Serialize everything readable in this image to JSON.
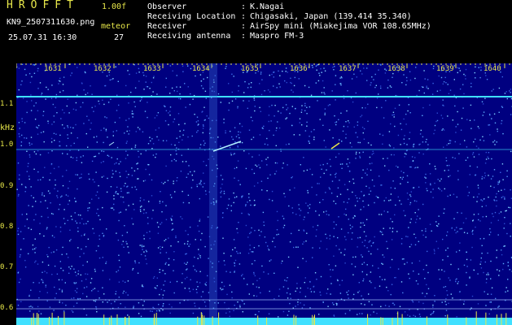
{
  "header": {
    "app_name": "HROFFT",
    "version": "1.00f",
    "filename": "KN9_2507311630.png",
    "datetime": "25.07.31 16:30",
    "meteor_label": "meteor",
    "meteor_count": "27"
  },
  "info": [
    {
      "label": "Observer",
      "value": "K.Nagai"
    },
    {
      "label": "Receiving Location",
      "value": "Chigasaki, Japan (139.414 35.340)"
    },
    {
      "label": "Receiver",
      "value": "AirSpy mini (Miakejima VOR 108.65MHz)"
    },
    {
      "label": "Receiving antenna",
      "value": "Maspro FM-3"
    }
  ],
  "separator": ":",
  "axis": {
    "y_unit": "kHz",
    "y_ticks": [
      "1.1",
      "1.0",
      "0.9",
      "0.8",
      "0.7",
      "0.6"
    ],
    "x_ticks": [
      "1631",
      "1632",
      "1633",
      "1634",
      "1635",
      "1636",
      "1637",
      "1638",
      "1639",
      "1640"
    ]
  },
  "colors": {
    "label": "#e8e84a",
    "text": "#ffffff",
    "background": "#000080",
    "carrier": "#40e0ff"
  }
}
